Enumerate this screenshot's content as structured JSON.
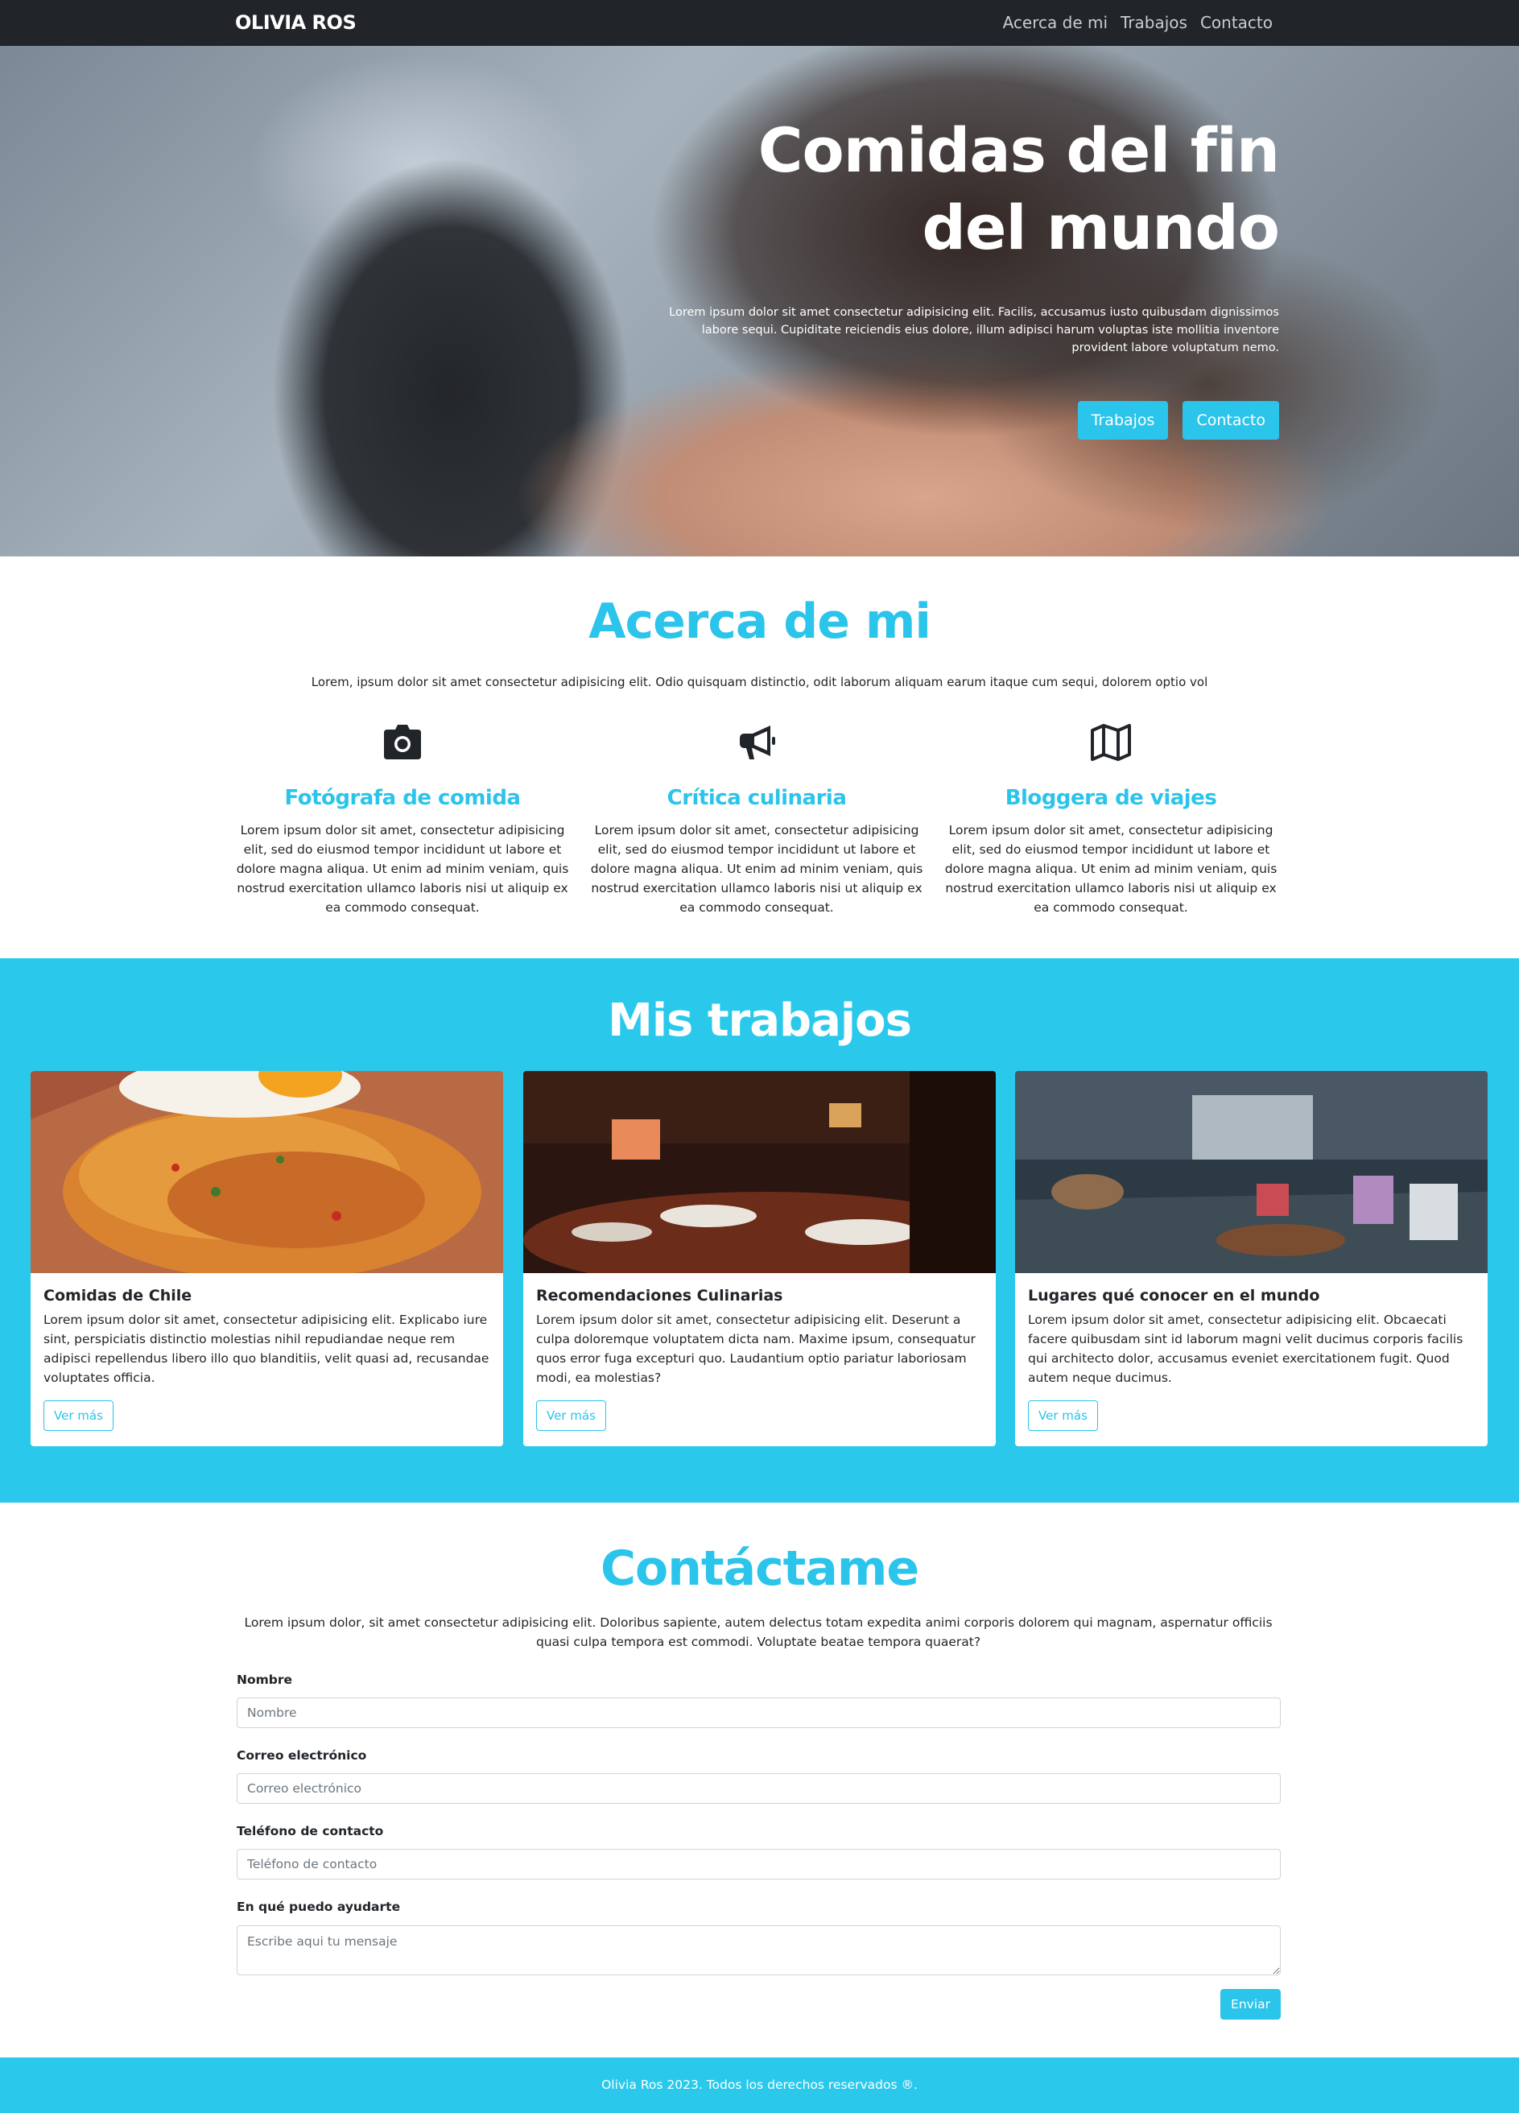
{
  "nav": {
    "brand": "OLIVIA ROS",
    "links": [
      "Acerca de mi",
      "Trabajos",
      "Contacto"
    ]
  },
  "hero": {
    "title_line1": "Comidas del fin",
    "title_line2": "del mundo",
    "text": "Lorem ipsum dolor sit amet consectetur adipisicing elit. Facilis, accusamus iusto quibusdam dignissimos labore sequi. Cupiditate reiciendis eius dolore, illum adipisci harum voluptas iste mollitia inventore provident labore voluptatum nemo.",
    "button_works": "Trabajos",
    "button_contact": "Contacto"
  },
  "about": {
    "title": "Acerca de mi",
    "lead": "Lorem, ipsum dolor sit amet consectetur adipisicing elit. Odio quisquam distinctio, odit laborum aliquam earum itaque cum sequi, dolorem optio vol",
    "features": [
      {
        "icon": "camera-icon",
        "title": "Fotógrafa de comida",
        "text": "Lorem ipsum dolor sit amet, consectetur adipisicing elit, sed do eiusmod tempor incididunt ut labore et dolore magna aliqua. Ut enim ad minim veniam, quis nostrud exercitation ullamco laboris nisi ut aliquip ex ea commodo consequat."
      },
      {
        "icon": "megaphone-icon",
        "title": "Crítica culinaria",
        "text": "Lorem ipsum dolor sit amet, consectetur adipisicing elit, sed do eiusmod tempor incididunt ut labore et dolore magna aliqua. Ut enim ad minim veniam, quis nostrud exercitation ullamco laboris nisi ut aliquip ex ea commodo consequat."
      },
      {
        "icon": "map-icon",
        "title": "Bloggera de viajes",
        "text": "Lorem ipsum dolor sit amet, consectetur adipisicing elit, sed do eiusmod tempor incididunt ut labore et dolore magna aliqua. Ut enim ad minim veniam, quis nostrud exercitation ullamco laboris nisi ut aliquip ex ea commodo consequat."
      }
    ]
  },
  "works": {
    "title": "Mis trabajos",
    "cards": [
      {
        "title": "Comidas de Chile",
        "text": "Lorem ipsum dolor sit amet, consectetur adipisicing elit. Explicabo iure sint, perspiciatis distinctio molestias nihil repudiandae neque rem adipisci repellendus libero illo quo blanditiis, velit quasi ad, recusandae voluptates officia.",
        "button": "Ver más"
      },
      {
        "title": "Recomendaciones Culinarias",
        "text": "Lorem ipsum dolor sit amet, consectetur adipisicing elit. Deserunt a culpa doloremque voluptatem dicta nam. Maxime ipsum, consequatur quos error fuga excepturi quo. Laudantium optio pariatur laboriosam modi, ea molestias?",
        "button": "Ver más"
      },
      {
        "title": "Lugares qué conocer en el mundo",
        "text": "Lorem ipsum dolor sit amet, consectetur adipisicing elit. Obcaecati facere quibusdam sint id laborum magni velit ducimus corporis facilis qui architecto dolor, accusamus eveniet exercitationem fugit. Quod autem neque ducimus.",
        "button": "Ver más"
      }
    ]
  },
  "contact": {
    "title": "Contáctame",
    "lead": "Lorem ipsum dolor, sit amet consectetur adipisicing elit. Doloribus sapiente, autem delectus totam expedita animi corporis dolorem qui magnam, aspernatur officiis quasi culpa tempora est commodi. Voluptate beatae tempora quaerat?",
    "name_label": "Nombre",
    "name_placeholder": "Nombre",
    "email_label": "Correo electrónico",
    "email_placeholder": "Correo electrónico",
    "phone_label": "Teléfono de contacto",
    "phone_placeholder": "Teléfono de contacto",
    "message_label": "En qué puedo ayudarte",
    "message_placeholder": "Escribe aqui tu mensaje",
    "send_button": "Enviar"
  },
  "footer": {
    "text": "Olivia Ros 2023. Todos los derechos reservados ®."
  },
  "colors": {
    "accent": "#2bc4ea",
    "navbar": "#212529",
    "section_bg": "#2ac9ec"
  }
}
